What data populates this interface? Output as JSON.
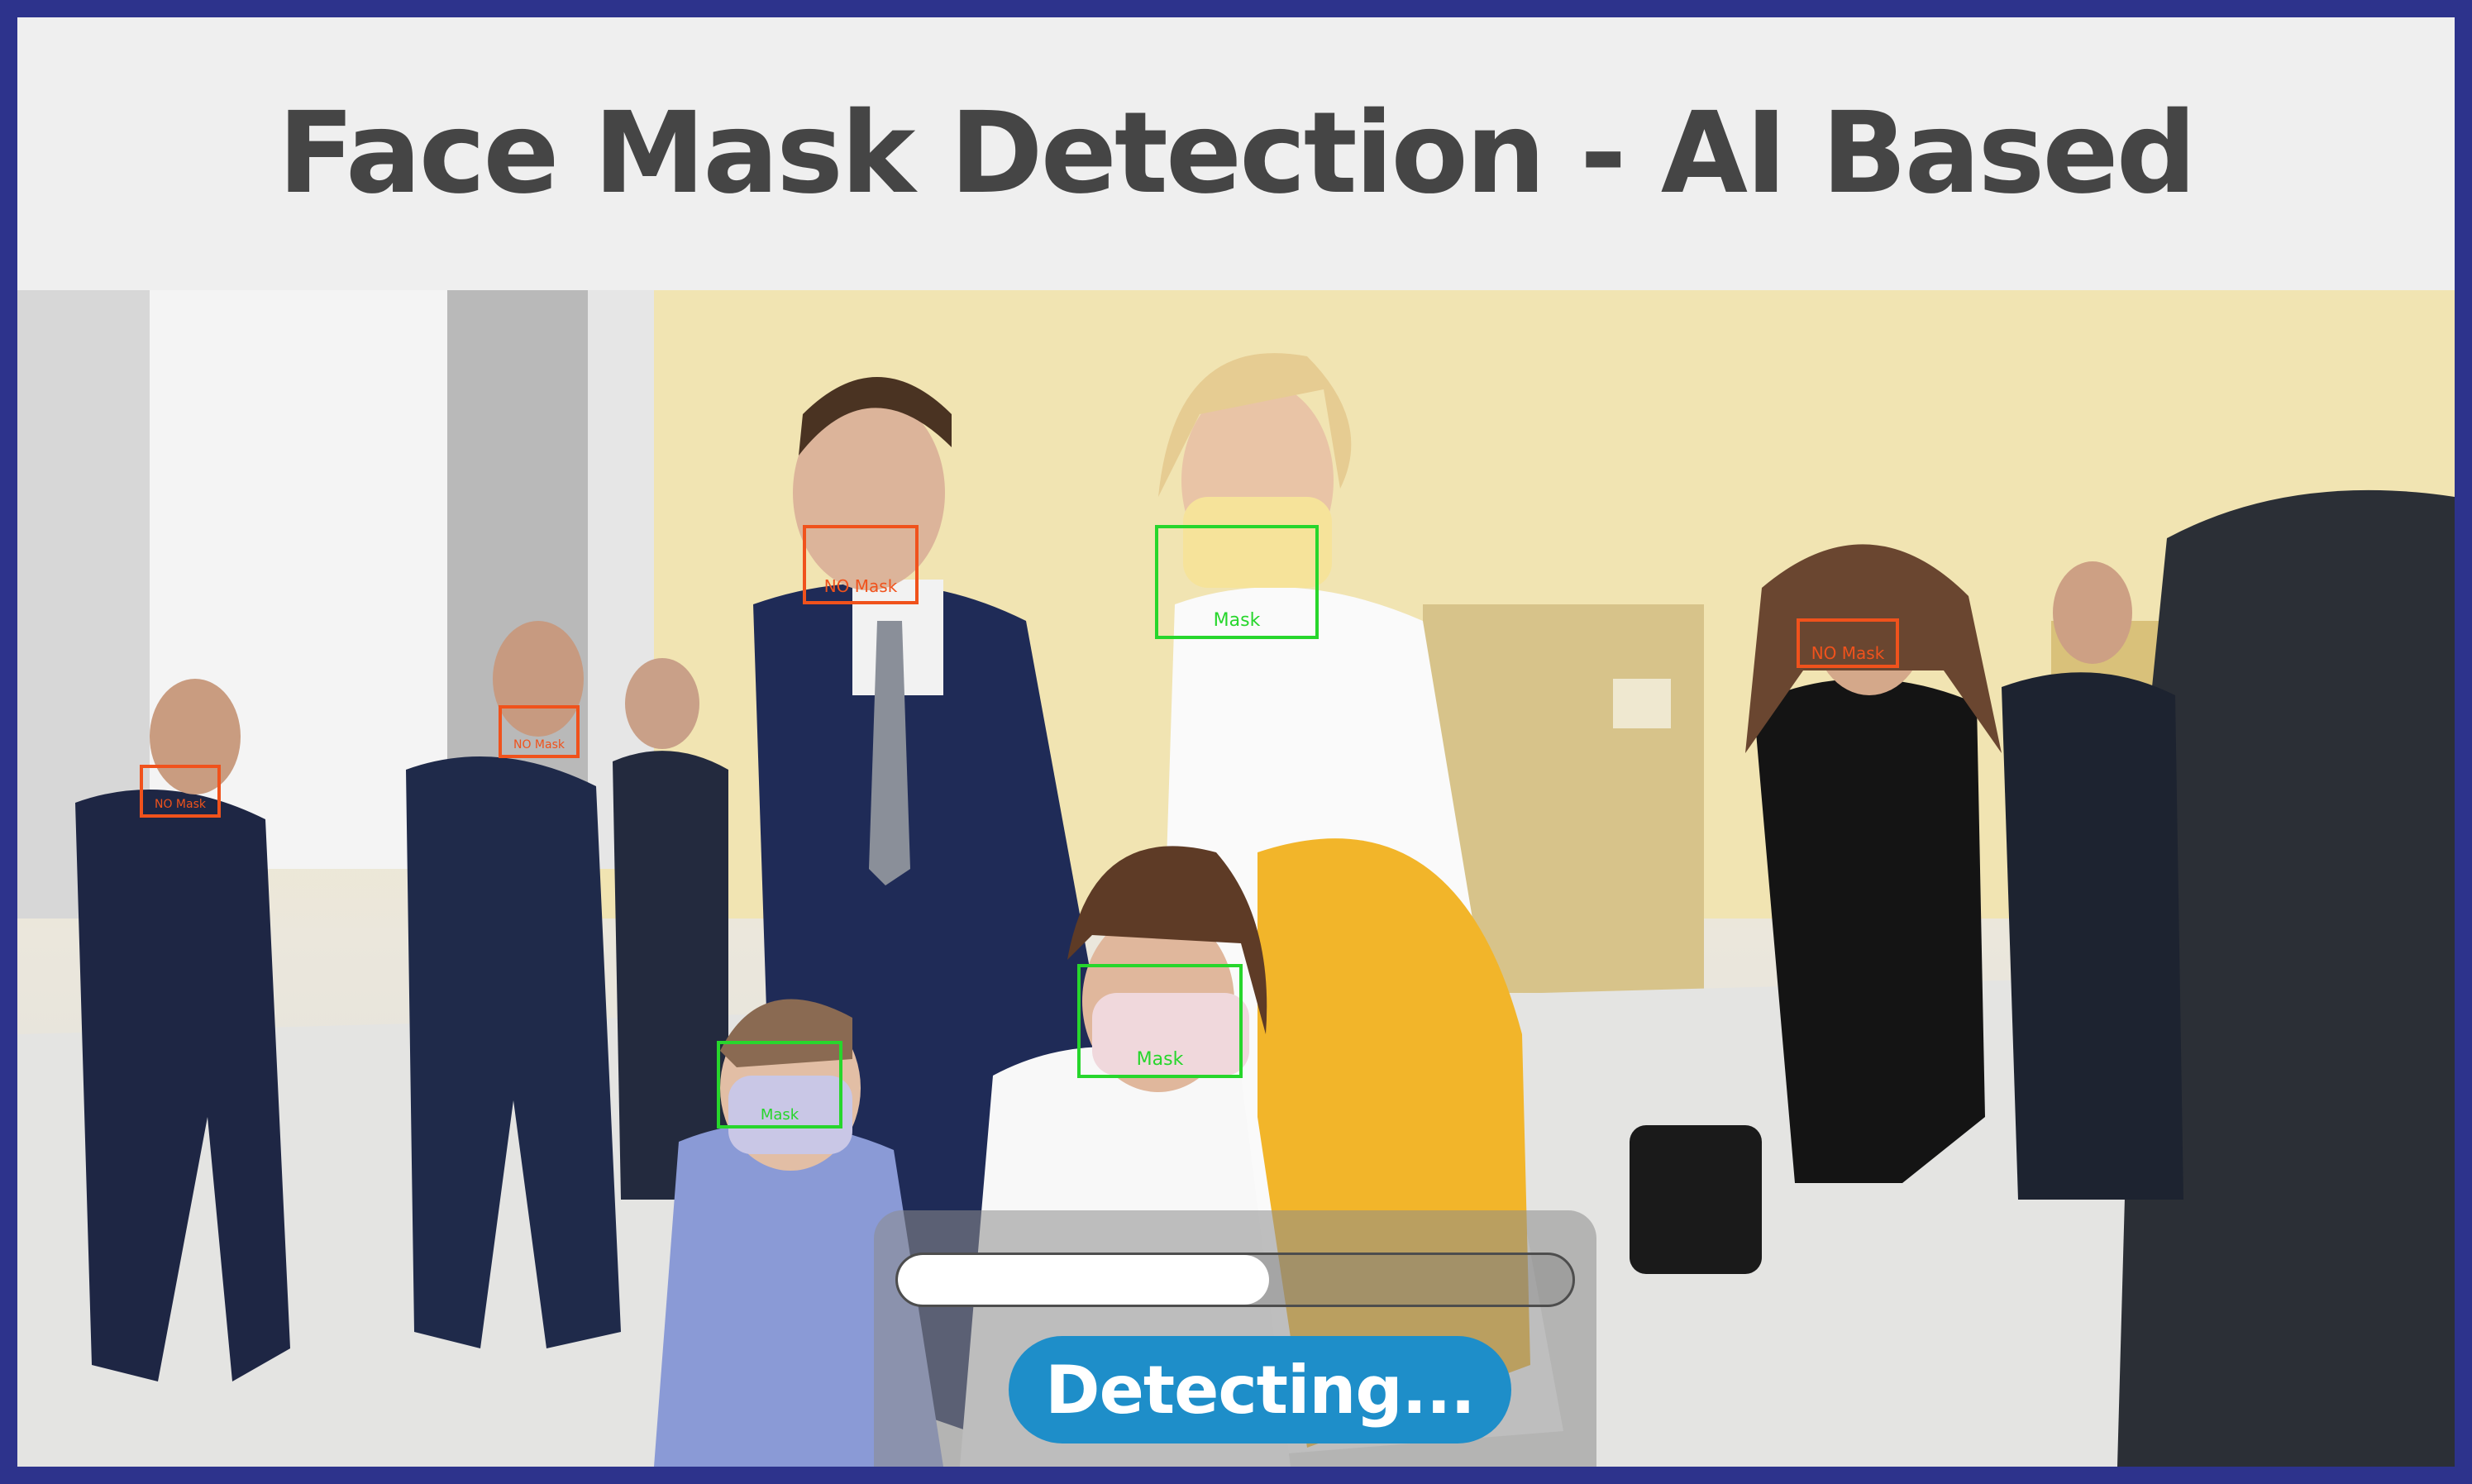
{
  "header": {
    "title": "Face Mask Detection - AI Based"
  },
  "colors": {
    "frame": "#2d338c",
    "header_bg": "#efefef",
    "title": "#454545",
    "mask_box": "#27d62c",
    "no_mask_box": "#f0521c",
    "button": "#1e8ec9"
  },
  "detections": [
    {
      "label": "NO Mask",
      "status": "no-mask"
    },
    {
      "label": "Mask",
      "status": "mask"
    },
    {
      "label": "NO Mask",
      "status": "no-mask"
    },
    {
      "label": "NO Mask",
      "status": "no-mask"
    },
    {
      "label": "NO Mask",
      "status": "no-mask"
    },
    {
      "label": "Mask",
      "status": "mask"
    },
    {
      "label": "Mask",
      "status": "mask"
    }
  ],
  "progress": {
    "fraction": 0.55
  },
  "action": {
    "label": "Detecting..."
  }
}
